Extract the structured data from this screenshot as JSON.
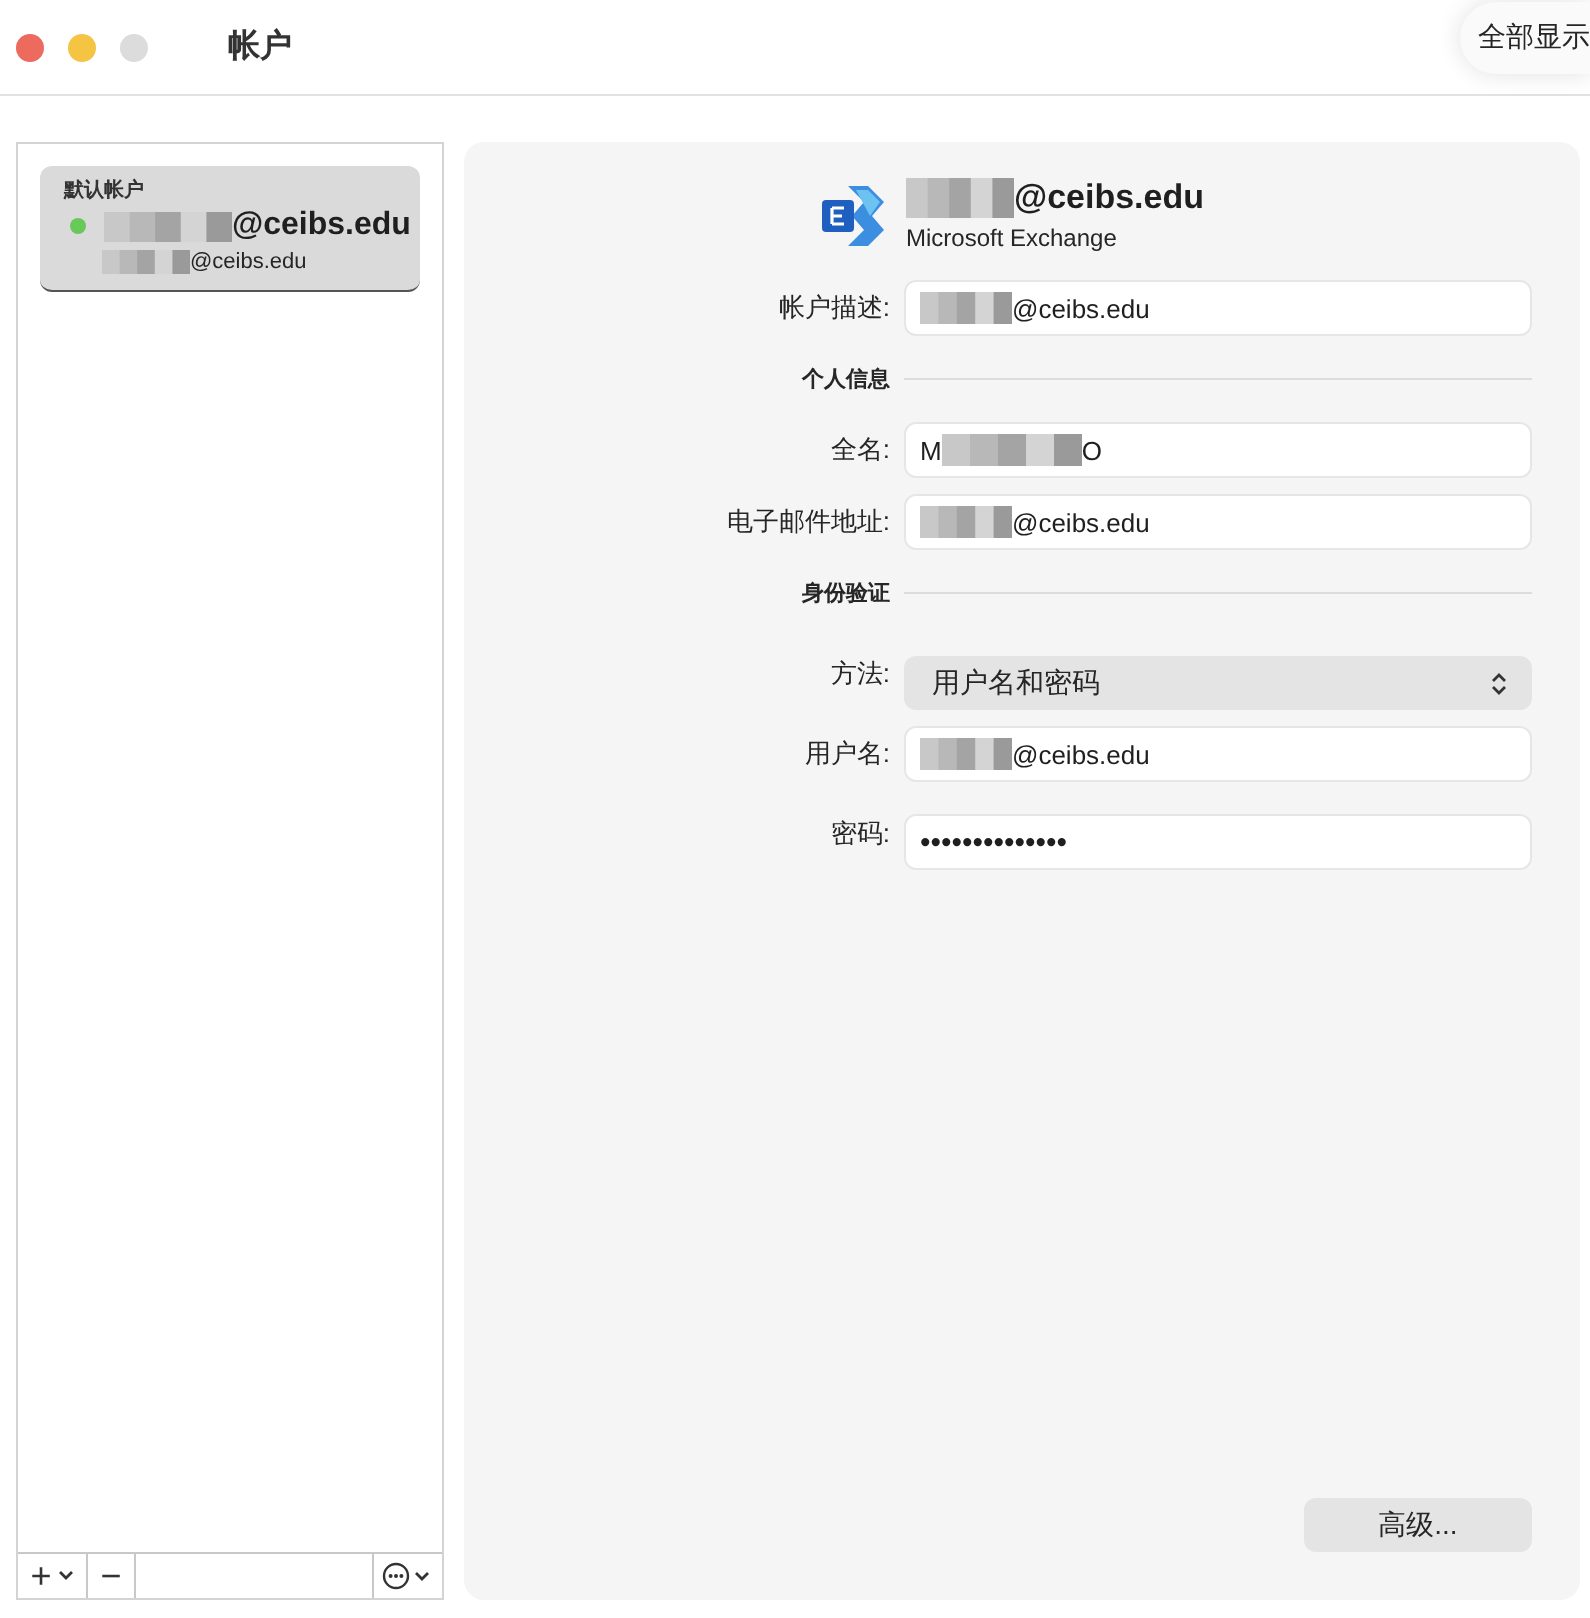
{
  "window": {
    "title": "帐户",
    "show_all_button": "全部显示",
    "traffic_lights": [
      {
        "kind": "close"
      },
      {
        "kind": "minimize"
      },
      {
        "kind": "zoom"
      }
    ]
  },
  "sidebar": {
    "items": [
      {
        "group_label": "默认帐户",
        "title": "@ceibs.edu",
        "subtitle": "@ceibs.edu",
        "redacted": true,
        "online": true,
        "selected": true
      }
    ],
    "toolbar": [
      {
        "kind": "add",
        "text": "+"
      },
      {
        "kind": "remove",
        "text": "−"
      },
      {
        "kind": "spacer"
      },
      {
        "kind": "more"
      }
    ]
  },
  "account": {
    "title": "@ceibs.edu",
    "redacted": true,
    "type": "Microsoft Exchange"
  },
  "form": [
    {
      "kind": "field",
      "label": "帐户描述:",
      "value": "@ceibs.edu",
      "redacted": true
    },
    {
      "kind": "section",
      "label": "个人信息"
    },
    {
      "kind": "field",
      "label": "全名:",
      "value_start": "M",
      "value": "O",
      "redacted": true
    },
    {
      "kind": "field",
      "label": "电子邮件地址:",
      "value": "@ceibs.edu",
      "redacted": true
    },
    {
      "kind": "section",
      "label": "身份验证"
    },
    {
      "kind": "popup",
      "label": "方法:",
      "value": "用户名和密码"
    },
    {
      "kind": "field",
      "label": "用户名:",
      "value": "@ceibs.edu",
      "redacted": true
    },
    {
      "kind": "password",
      "label": "密码:",
      "value": "••••••••••••••"
    }
  ],
  "advanced_button": "高级..."
}
